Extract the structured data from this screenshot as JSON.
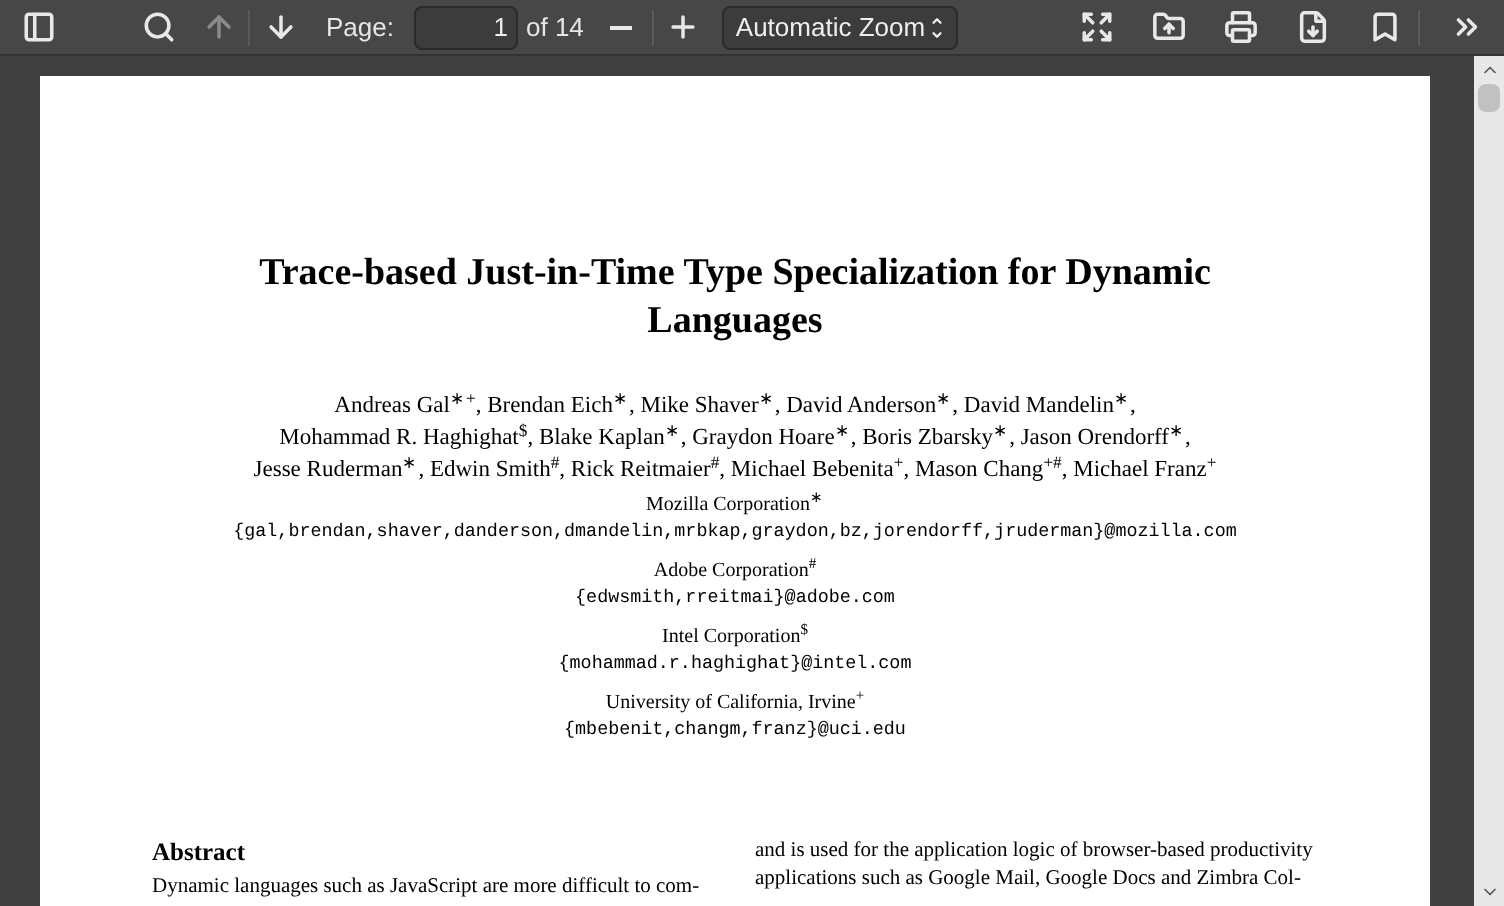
{
  "toolbar": {
    "left_buttons": [
      {
        "kind": "sidebar",
        "disabled": false
      },
      {
        "kind": "search",
        "disabled": false
      },
      {
        "kind": "previous",
        "disabled": true
      },
      {
        "kind": "next",
        "disabled": false
      }
    ],
    "page_label": "Page:",
    "page_value": "1",
    "page_count": "of 14",
    "zoom_buttons": [
      {
        "kind": "zoom-out",
        "disabled": false
      },
      {
        "kind": "zoom-in",
        "disabled": false
      }
    ],
    "zoom_select": "Automatic Zoom",
    "right_buttons": [
      {
        "kind": "fullscreen",
        "disabled": false
      },
      {
        "kind": "open",
        "disabled": false
      },
      {
        "kind": "print",
        "disabled": false
      },
      {
        "kind": "download",
        "disabled": false
      },
      {
        "kind": "bookmark",
        "disabled": false
      },
      {
        "kind": "more",
        "disabled": false
      }
    ]
  },
  "document": {
    "title": "Trace-based Just-in-Time Type Specialization for Dynamic Languages",
    "authors": [
      "Andreas Gal$^{∗+}$, Brendan Eich$^{∗}$, Mike Shaver$^{∗}$, David Anderson$^{∗}$, David Mandelin$^{∗}$,",
      "Mohammad R. Haghighat$^{$}$, Blake Kaplan$^{∗}$, Graydon Hoare$^{∗}$, Boris Zbarsky$^{∗}$, Jason Orendorff$^{∗}$,",
      "Jesse Ruderman$^{∗}$, Edwin Smith$^{#}$, Rick Reitmaier$^{#}$, Michael Bebenita$^{+}$, Mason Chang$^{+#}$, Michael Franz$^{+}$"
    ],
    "affiliations": [
      {
        "name": "Mozilla Corporation$^{∗}$",
        "email": "{gal,brendan,shaver,danderson,dmandelin,mrbkap,graydon,bz,jorendorff,jruderman}@mozilla.com"
      },
      {
        "name": "Adobe Corporation$^{#}$",
        "email": "{edwsmith,rreitmai}@adobe.com"
      },
      {
        "name": "Intel Corporation$^{$}$",
        "email": "{mohammad.r.haghighat}@intel.com"
      },
      {
        "name": "University of California, Irvine$^{+}$",
        "email": "{mbebenit,changm,franz}@uci.edu"
      }
    ],
    "abstract_heading": "Abstract",
    "left_column": [
      "Dynamic languages such as JavaScript are more difficult to com-"
    ],
    "right_column": [
      "and is used for the application logic of browser-based productivity",
      "applications such as Google Mail, Google Docs and Zimbra Col-"
    ]
  }
}
